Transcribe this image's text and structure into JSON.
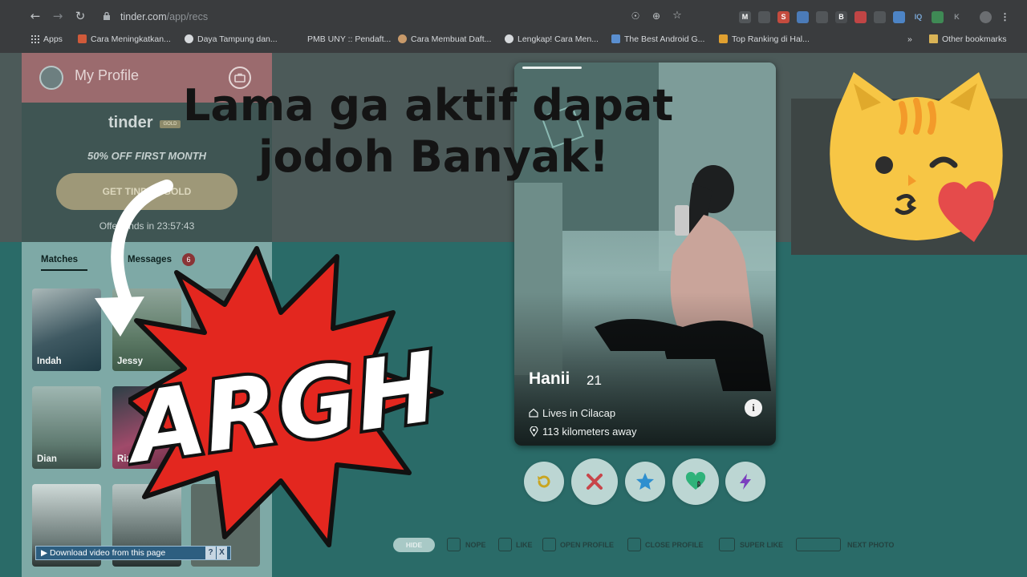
{
  "browser": {
    "url_host": "tinder.com",
    "url_path": "/app/recs",
    "bookmarks": [
      {
        "label": "Apps"
      },
      {
        "label": "Cara Meningkatkan..."
      },
      {
        "label": "Daya Tampung dan..."
      },
      {
        "label": "PMB UNY :: Pendaft..."
      },
      {
        "label": "Cara Membuat Daft..."
      },
      {
        "label": "Lengkap! Cara Men..."
      },
      {
        "label": "The Best Android G..."
      },
      {
        "label": "Top Ranking di Hal..."
      },
      {
        "label": "»"
      },
      {
        "label": "Other bookmarks"
      }
    ],
    "extensions": [
      "M",
      "",
      "S",
      "",
      "",
      "B",
      "",
      "",
      "",
      "IQ",
      "",
      "K"
    ]
  },
  "sidebar": {
    "profile_label": "My Profile",
    "logo_text": "tinder",
    "gold_tag": "GOLD",
    "offer_text": "50% OFF FIRST MONTH",
    "gold_button": "GET TINDER GOLD",
    "timer_text": "Offer ends in 23:57:43",
    "tab_matches": "Matches",
    "tab_messages": "Messages",
    "messages_count": "6",
    "matches": [
      {
        "name": "Indah"
      },
      {
        "name": "Jessy"
      },
      {
        "name": ""
      },
      {
        "name": "Dian"
      },
      {
        "name": "Rizk"
      },
      {
        "name": ""
      },
      {
        "name": ""
      },
      {
        "name": ""
      }
    ]
  },
  "card": {
    "name": "Hanii",
    "age": "21",
    "location": "Lives in Cilacap",
    "distance": "113 kilometers away",
    "info_label": "i"
  },
  "shortcuts": {
    "hide": "HIDE",
    "nope": "NOPE",
    "like": "LIKE",
    "open_profile": "OPEN PROFILE",
    "close_profile": "CLOSE PROFILE",
    "super_like": "SUPER LIKE",
    "next_photo": "NEXT PHOTO"
  },
  "overlay": {
    "headline_line1": "Lama ga aktif dapat",
    "headline_line2": "jodoh Banyak!",
    "sticker_text": "ARGH",
    "download_text": "Download video from this page",
    "download_help": "?",
    "download_close": "X"
  },
  "colors": {
    "accent_red": "#e3271f",
    "tinder_teal": "#2a6b68",
    "cat_yellow": "#f7c645",
    "heart_red": "#e54b4b"
  }
}
